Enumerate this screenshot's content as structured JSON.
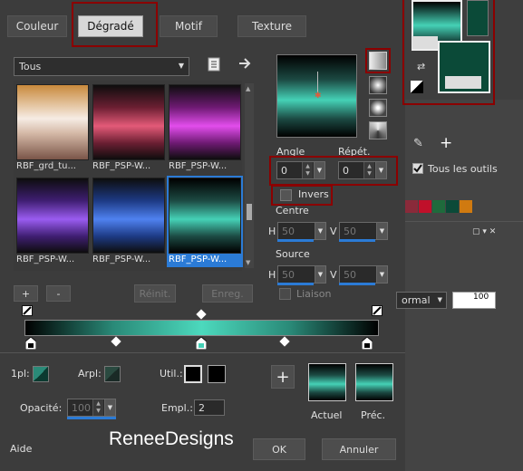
{
  "tabs": [
    "Couleur",
    "Dégradé",
    "Motif",
    "Texture"
  ],
  "category_select": "Tous",
  "thumbnails": [
    {
      "label": "RBF_grd_tu...",
      "gradient": "linear-gradient(to bottom,#c98a3c 0%,#f6ece4 45%,#d4b8a6 65%,#7a5548 100%)",
      "selected": false
    },
    {
      "label": "RBF_PSP-W...",
      "gradient": "linear-gradient(to bottom,#0d0d0d 0%,#6b1f32 30%,#e35a78 55%,#6b1f32 78%,#0d0d0d 100%)",
      "selected": false
    },
    {
      "label": "RBF_PSP-W...",
      "gradient": "linear-gradient(to bottom,#0d0d0d 0%,#6e1a73 30%,#e24dec 55%,#6e1a73 78%,#0d0d0d 100%)",
      "selected": false
    },
    {
      "label": "RBF_PSP-W...",
      "gradient": "linear-gradient(to bottom,#0d0d0d 0%,#3f1e72 30%,#9a5cf0 55%,#3f1e72 78%,#0d0d0d 100%)",
      "selected": false
    },
    {
      "label": "RBF_PSP-W...",
      "gradient": "linear-gradient(to bottom,#0d0d0d 0%,#1d3a84 30%,#4f82f0 55%,#1d3a84 78%,#0d0d0d 100%)",
      "selected": false
    },
    {
      "label": "RBF_PSP-W...",
      "gradient": "linear-gradient(to bottom,#000 0%,#1c4a43 30%,#45d1b6 55%,#1c4a43 78%,#000 100%)",
      "selected": true
    }
  ],
  "buttons": {
    "add": "+",
    "remove": "-",
    "reset": "Réinit.",
    "save": "Enreg.",
    "ok": "OK",
    "cancel": "Annuler",
    "help": "Aide"
  },
  "angle": {
    "label": "Angle",
    "value": "0"
  },
  "repeat": {
    "label": "Répét.",
    "value": "0"
  },
  "invert": {
    "label": "Invers"
  },
  "center": {
    "label": "Centre",
    "h_label": "H",
    "h_value": "50",
    "v_label": "V",
    "v_value": "50"
  },
  "source": {
    "label": "Source",
    "h_label": "H",
    "h_value": "50",
    "v_label": "V",
    "v_value": "50"
  },
  "link": {
    "label": "Liaison"
  },
  "stops": {
    "start_label": "1pl:",
    "end_label": "Arpl:",
    "use_label": "Util.:"
  },
  "opacity": {
    "label": "Opacité:",
    "value": "100",
    "progress": 100
  },
  "location": {
    "label": "Empl.:",
    "value": "2"
  },
  "preview": {
    "current_label": "Actuel",
    "previous_label": "Préc."
  },
  "watermark": "ReneeDesigns",
  "right_panel": {
    "all_tools": "Tous les outils",
    "blend_mode": "ormal",
    "opacity_value": "100"
  },
  "colors": {
    "accent": "#2b7bd6",
    "highlight": "#8b0000",
    "teal": "#45d1b6",
    "dark_green": "#0b4a38"
  },
  "swatches": [
    "#8a2a3a",
    "#c0102a",
    "#1f6a3c",
    "#0b4a38",
    "#d07a10"
  ]
}
